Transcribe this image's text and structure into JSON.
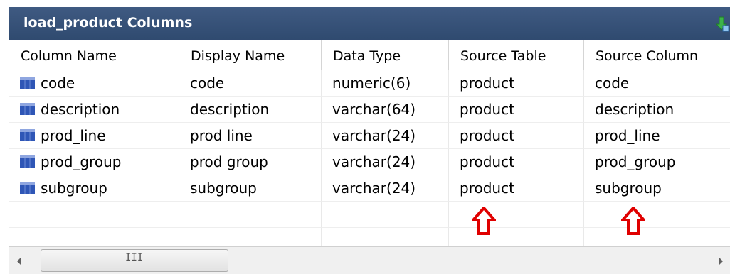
{
  "panel": {
    "title": "load_product Columns",
    "pin_icon": "pin-icon"
  },
  "columns": [
    "Column Name",
    "Display Name",
    "Data Type",
    "Source Table",
    "Source Column"
  ],
  "rows": [
    {
      "column_name": "code",
      "display_name": "code",
      "data_type": "numeric(6)",
      "source_table": "product",
      "source_column": "code"
    },
    {
      "column_name": "description",
      "display_name": "description",
      "data_type": "varchar(64)",
      "source_table": "product",
      "source_column": "description"
    },
    {
      "column_name": "prod_line",
      "display_name": "prod line",
      "data_type": "varchar(24)",
      "source_table": "product",
      "source_column": "prod_line"
    },
    {
      "column_name": "prod_group",
      "display_name": "prod group",
      "data_type": "varchar(24)",
      "source_table": "product",
      "source_column": "prod_group"
    },
    {
      "column_name": "subgroup",
      "display_name": "subgroup",
      "data_type": "varchar(24)",
      "source_table": "product",
      "source_column": "subgroup"
    }
  ],
  "scrollbar": {
    "grip": "III"
  },
  "colors": {
    "titlebar": "#34507a",
    "arrow": "#e00000",
    "table_icon": "#2f56b6"
  }
}
